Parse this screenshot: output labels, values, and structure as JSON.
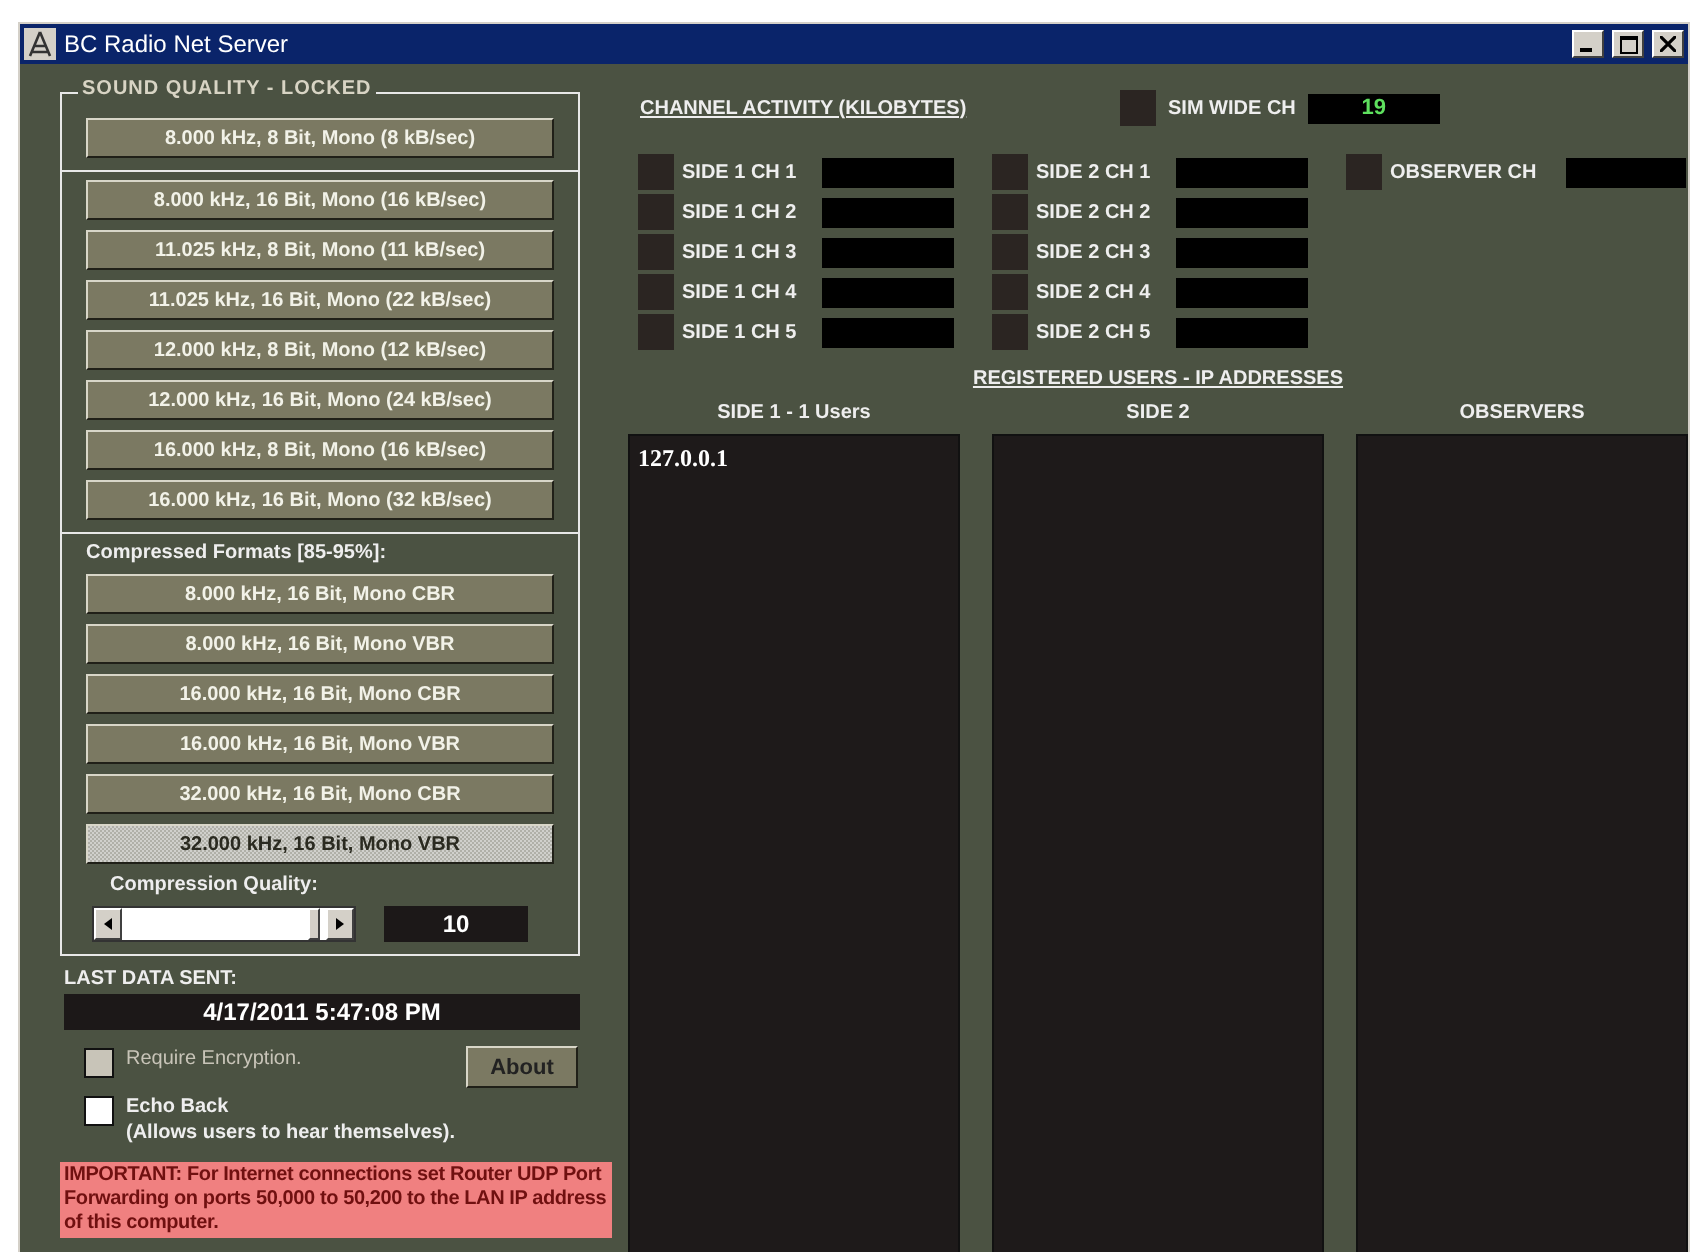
{
  "window": {
    "title": "BC Radio Net Server"
  },
  "sound_quality": {
    "legend": "SOUND QUALITY - LOCKED",
    "groups": [
      [
        {
          "label": "8.000 kHz, 8 Bit, Mono (8 kB/sec)",
          "selected": false
        }
      ],
      [
        {
          "label": "8.000 kHz, 16 Bit, Mono (16 kB/sec)",
          "selected": false
        },
        {
          "label": "11.025 kHz, 8 Bit, Mono (11 kB/sec)",
          "selected": false
        },
        {
          "label": "11.025 kHz, 16 Bit, Mono (22 kB/sec)",
          "selected": false
        },
        {
          "label": "12.000 kHz, 8 Bit, Mono (12 kB/sec)",
          "selected": false
        },
        {
          "label": "12.000 kHz, 16 Bit, Mono (24 kB/sec)",
          "selected": false
        },
        {
          "label": "16.000 kHz, 8 Bit, Mono (16 kB/sec)",
          "selected": false
        },
        {
          "label": "16.000 kHz, 16 Bit, Mono (32 kB/sec)",
          "selected": false
        }
      ]
    ],
    "compressed_heading": "Compressed Formats [85-95%]:",
    "compressed": [
      {
        "label": "8.000 kHz, 16 Bit, Mono CBR",
        "selected": false
      },
      {
        "label": "8.000 kHz, 16 Bit, Mono VBR",
        "selected": false
      },
      {
        "label": "16.000 kHz, 16 Bit, Mono CBR",
        "selected": false
      },
      {
        "label": "16.000 kHz, 16 Bit, Mono VBR",
        "selected": false
      },
      {
        "label": "32.000 kHz, 16 Bit, Mono CBR",
        "selected": false
      },
      {
        "label": "32.000 kHz, 16 Bit, Mono VBR",
        "selected": true
      }
    ],
    "compression_quality": {
      "label": "Compression Quality:",
      "level": 0.97,
      "value": "10"
    }
  },
  "last_data_sent": {
    "label": "LAST DATA SENT:",
    "value": "4/17/2011 5:47:08 PM"
  },
  "options": [
    {
      "label": "Require Encryption.",
      "checked": false,
      "disabled": true
    },
    {
      "label": "Echo Back",
      "note": "(Allows users to hear themselves).",
      "checked": false,
      "disabled": false
    }
  ],
  "about_button": "About",
  "important": "IMPORTANT: For Internet connections set Router UDP Port Forwarding on ports 50,000 to 50,200 to the LAN IP address of this computer.",
  "channel_activity": {
    "title": "CHANNEL ACTIVITY (KILOBYTES)",
    "sim_wide": {
      "label": "SIM WIDE CH",
      "value": "19"
    },
    "columns": [
      [
        "SIDE 1 CH 1",
        "SIDE 1 CH 2",
        "SIDE 1 CH 3",
        "SIDE 1 CH 4",
        "SIDE 1 CH 5"
      ],
      [
        "SIDE 2 CH 1",
        "SIDE 2 CH 2",
        "SIDE 2 CH 3",
        "SIDE 2 CH 4",
        "SIDE 2 CH 5"
      ],
      [
        "OBSERVER CH"
      ]
    ]
  },
  "registered_users": {
    "title": "REGISTERED USERS - IP ADDRESSES",
    "lists": [
      {
        "heading": "SIDE 1 - 1 Users",
        "items": [
          "127.0.0.1"
        ]
      },
      {
        "heading": "SIDE 2"
      },
      {
        "heading": "OBSERVERS"
      }
    ]
  }
}
